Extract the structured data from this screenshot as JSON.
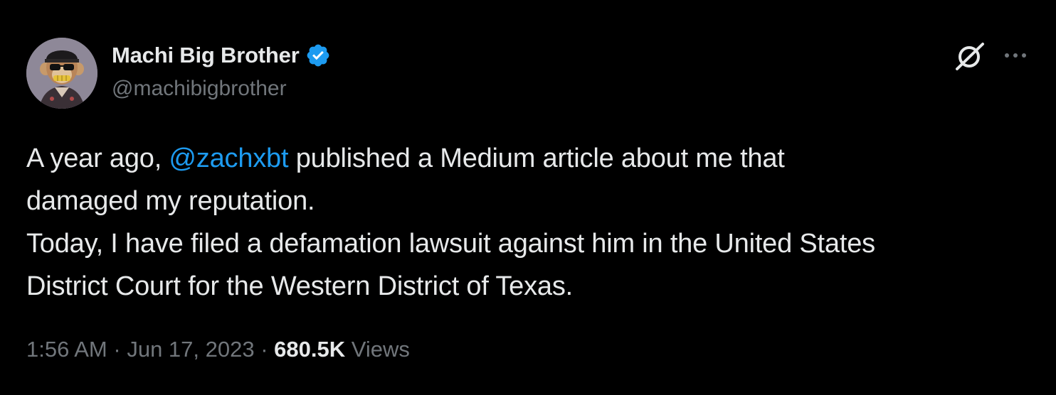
{
  "author": {
    "display_name": "Machi Big Brother",
    "handle": "@machibigbrother",
    "verified": true
  },
  "tweet": {
    "line1_before": "A year ago, ",
    "mention": "@zachxbt",
    "line1_after": " published a Medium article about me that",
    "line2": "damaged my reputation.",
    "line3": "Today, I have filed a defamation lawsuit against him in the United States",
    "line4": "District Court for the Western District of Texas."
  },
  "meta": {
    "time": "1:56 AM",
    "separator": "·",
    "date": "Jun 17, 2023",
    "views_count": "680.5K",
    "views_label": "Views"
  },
  "icons": {
    "verified": "verified-badge-icon",
    "grok": "grok-icon",
    "more": "more-options-icon"
  },
  "colors": {
    "background": "#000000",
    "text": "#e7e9ea",
    "secondary": "#71767b",
    "accent": "#1d9bf0"
  }
}
